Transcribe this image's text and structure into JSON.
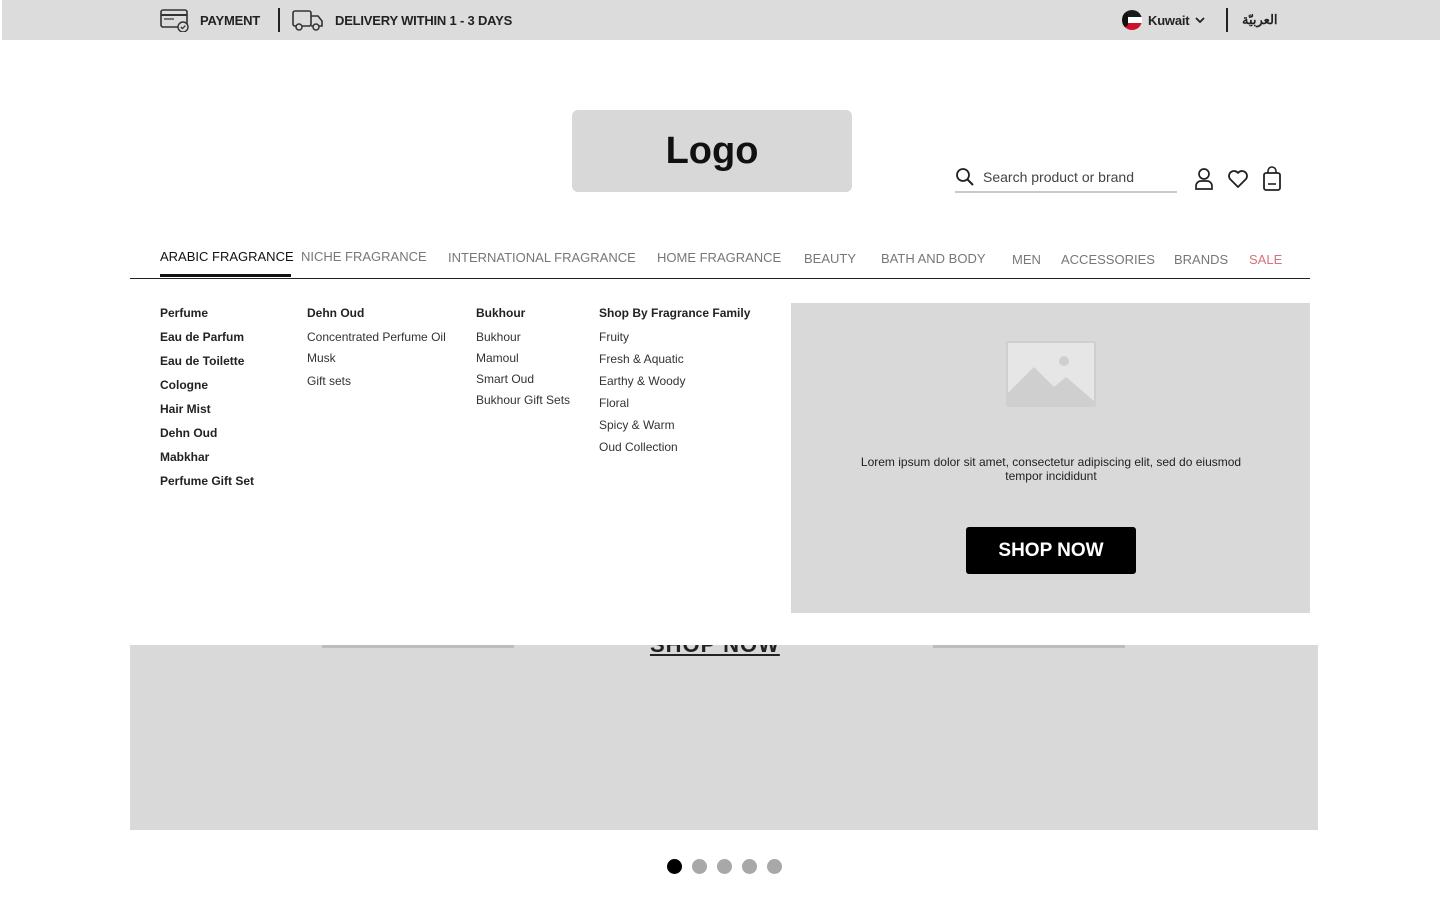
{
  "topbar": {
    "payment_label": "PAYMENT",
    "delivery_label": "DELIVERY WITHIN 1 - 3 DAYS",
    "country_label": "Kuwait",
    "language_label": "العربيّة"
  },
  "header": {
    "logo_text": "Logo",
    "search_placeholder": "Search product or brand"
  },
  "nav": {
    "items": [
      "ARABIC FRAGRANCE",
      "NICHE FRAGRANCE",
      "INTERNATIONAL FRAGRANCE",
      "HOME FRAGRANCE",
      "BEAUTY",
      "BATH AND BODY",
      "MEN",
      "ACCESSORIES",
      "BRANDS",
      "SALE"
    ]
  },
  "mega_menu": {
    "col1": [
      "Perfume",
      "Eau de Parfum",
      "Eau de Toilette",
      "Cologne",
      "Hair Mist",
      "Dehn Oud",
      "Mabkhar",
      "Perfume Gift Set"
    ],
    "col2": {
      "title": "Dehn Oud",
      "items": [
        "Concentrated Perfume Oil",
        "Musk",
        "Gift sets"
      ]
    },
    "col3": {
      "title": "Bukhour",
      "items": [
        "Bukhour",
        "Mamoul",
        "Smart Oud",
        "Bukhour Gift Sets"
      ]
    },
    "col4": {
      "title": "Shop By Fragrance Family",
      "items": [
        "Fruity",
        "Fresh & Aquatic",
        "Earthy & Woody",
        "Floral",
        "Spicy & Warm",
        "Oud Collection"
      ]
    }
  },
  "promo": {
    "text": "Lorem ipsum dolor sit amet, consectetur adipiscing elit, sed do eiusmod tempor incididunt",
    "button_label": "SHOP NOW"
  },
  "hero": {
    "link_label": "SHOP NOW"
  },
  "carousel": {
    "dot_count": 5,
    "active_index": 0
  },
  "colors": {
    "topbar_bg": "#dcdcdc",
    "placeholder_gray": "#d9d9d9",
    "sale": "#d9707a",
    "button_bg": "#000000"
  }
}
